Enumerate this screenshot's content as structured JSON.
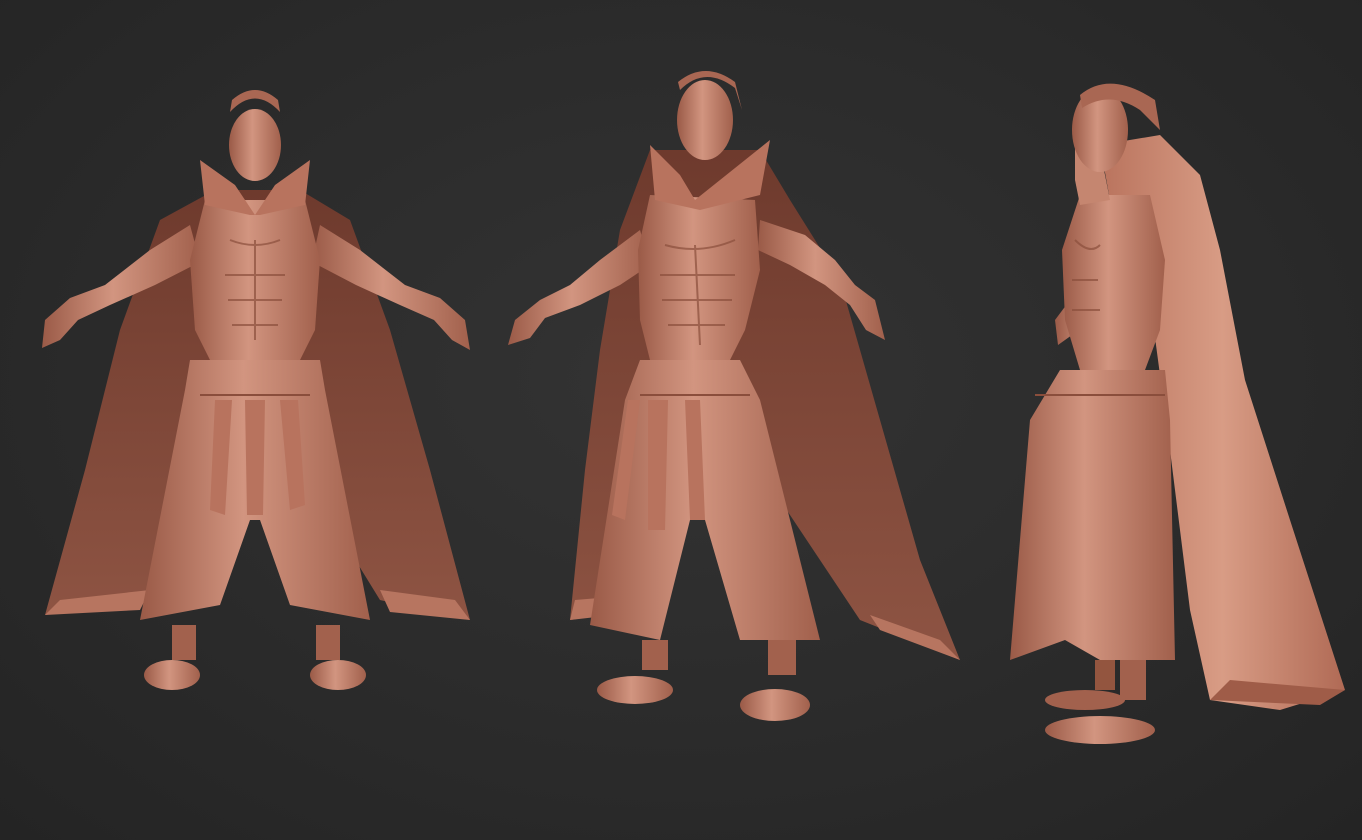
{
  "scene": {
    "background_color": "#2b2b2b",
    "clay_color": "#c98a72",
    "clay_shadow_color": "#8a4e3c",
    "clay_highlight_color": "#e2ab94",
    "views": [
      {
        "name": "front"
      },
      {
        "name": "three-quarter"
      },
      {
        "name": "side"
      }
    ]
  }
}
